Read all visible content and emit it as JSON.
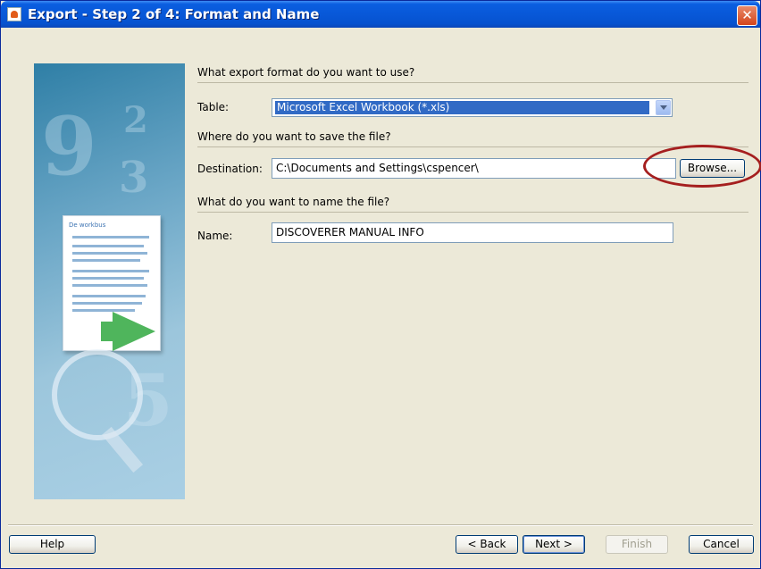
{
  "window": {
    "title": "Export - Step 2 of 4: Format and Name",
    "close_glyph": "✕"
  },
  "sections": {
    "format_question": "What export format do you want to use?",
    "save_question": "Where do you want to save the file?",
    "name_question": "What do you want to name the file?"
  },
  "fields": {
    "table_label": "Table:",
    "table_value": "Microsoft Excel Workbook (*.xls)",
    "destination_label": "Destination:",
    "destination_value": "C:\\Documents and Settings\\cspencer\\",
    "name_label": "Name:",
    "name_value": "DISCOVERER MANUAL INFO"
  },
  "buttons": {
    "browse": "Browse...",
    "help": "Help",
    "back": "< Back",
    "next": "Next >",
    "finish": "Finish",
    "cancel": "Cancel"
  },
  "illustration": {
    "doc_heading": "De workbus"
  },
  "colors": {
    "title_bar": "#0858d8",
    "selection": "#316ac5",
    "annotation": "#a51f1f",
    "dialog_bg": "#ece9d8"
  }
}
